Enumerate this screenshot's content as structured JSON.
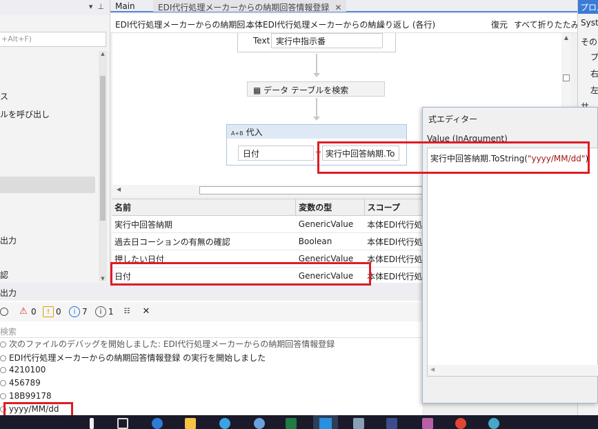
{
  "left_panel": {
    "search_placeholder": "+Alt+F)",
    "items": [
      "ス",
      "ルを呼び出し",
      "出力",
      "認"
    ]
  },
  "tabs": {
    "main": "Main",
    "active": "EDI代行処理メーカーからの納期回答情報登録",
    "close": "✕"
  },
  "breadcrumb": {
    "items": [
      "EDI代行処理メーカーからの納期回...",
      "本体EDI代行処理メーカーからの納...",
      "繰り返し (各行)"
    ],
    "restore": "復元",
    "collapse_all": "すべて折りたたみ"
  },
  "canvas": {
    "text_label": "Text",
    "text_value": "実行中指示番",
    "find_activity": "データ テーブルを検索",
    "assign_title": "代入",
    "assign_icon": "A+B",
    "assign_to": "日付",
    "assign_value": "実行中回答納期.To"
  },
  "variables": {
    "headers": [
      "名前",
      "変数の型",
      "スコープ"
    ],
    "rows": [
      [
        "実行中回答納期",
        "GenericValue",
        "本体EDI代行処"
      ],
      [
        "過去日コーションの有無の確認",
        "Boolean",
        "本体EDI代行処"
      ],
      [
        "押したい日付",
        "GenericValue",
        "本体EDI代行処"
      ],
      [
        "日付",
        "GenericValue",
        "本体EDI代行処"
      ]
    ]
  },
  "output": {
    "title": "出力",
    "counts": {
      "error": "0",
      "warning": "0",
      "info": "7",
      "trace": "1"
    },
    "search_placeholder": "検索",
    "logs": [
      "次のファイルのデバッグを開始しました: EDI代行処理メーカーからの納期回答情報登録",
      "EDI代行処理メーカーからの納期回答情報登録 の実行を開始しました",
      "4210100",
      "456789",
      "18B99178",
      "yyyy/MM/dd"
    ]
  },
  "properties": {
    "title": "プロパ",
    "items": [
      "System",
      "その",
      "プ",
      "右",
      "左",
      "共"
    ]
  },
  "expression_editor": {
    "title": "式エディター",
    "label": "Value (InArgument)",
    "code_prefix": "実行中回答納期.ToString(",
    "code_string": "\"yyyy/MM/dd\"",
    "code_suffix": ")"
  }
}
